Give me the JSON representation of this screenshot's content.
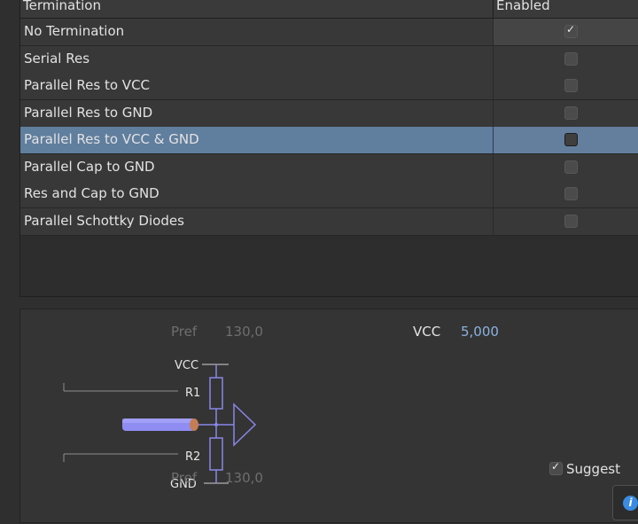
{
  "table": {
    "columns": [
      "Termination",
      "Enabled"
    ],
    "rows": [
      {
        "label": "No Termination",
        "enabled": true
      },
      {
        "label": "Serial Res",
        "enabled": false
      },
      {
        "label": "Parallel Res to VCC",
        "enabled": false
      },
      {
        "label": "Parallel Res to GND",
        "enabled": false
      },
      {
        "label": "Parallel Res to VCC & GND",
        "enabled": false,
        "selected": true
      },
      {
        "label": "Parallel Cap to GND",
        "enabled": false
      },
      {
        "label": "Res and Cap to GND",
        "enabled": false
      },
      {
        "label": "Parallel Schottky Diodes",
        "enabled": false
      }
    ]
  },
  "params": {
    "pref_top_label": "Pref",
    "pref_top_value": "130,0",
    "pref_bottom_label": "Pref",
    "pref_bottom_value": "130,0",
    "vcc_label": "VCC",
    "vcc_value": "5,000"
  },
  "schematic": {
    "vcc": "VCC",
    "gnd": "GND",
    "r1": "R1",
    "r2": "R2"
  },
  "suggest": {
    "label": "Suggest",
    "checked": true,
    "check_glyph": "✓"
  },
  "info_button": {
    "glyph": "i",
    "icon": "info-icon"
  },
  "colors": {
    "accent_blue": "#8bb2e0",
    "selection": "#607e9e",
    "schematic_stroke": "#8a86e8",
    "cable": "#8f8cf2",
    "connector": "#c47d55"
  }
}
